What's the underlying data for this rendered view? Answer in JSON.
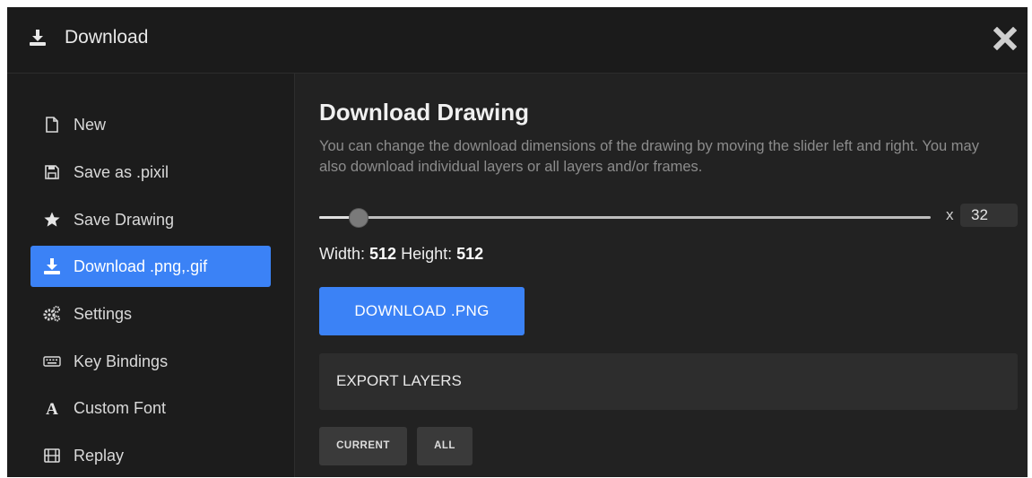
{
  "titlebar": {
    "title": "Download",
    "icon": "download-icon",
    "close_icon": "close-icon"
  },
  "sidebar": {
    "items": [
      {
        "label": "New",
        "icon": "file-icon",
        "active": false
      },
      {
        "label": "Save as .pixil",
        "icon": "floppy-disk-icon",
        "active": false
      },
      {
        "label": "Save Drawing",
        "icon": "star-icon",
        "active": false
      },
      {
        "label": "Download .png,.gif",
        "icon": "download-icon",
        "active": true
      },
      {
        "label": "Settings",
        "icon": "gears-icon",
        "active": false
      },
      {
        "label": "Key Bindings",
        "icon": "keyboard-icon",
        "active": false
      },
      {
        "label": "Custom Font",
        "icon": "font-icon",
        "active": false
      },
      {
        "label": "Replay",
        "icon": "film-icon",
        "active": false
      }
    ]
  },
  "main": {
    "heading": "Download Drawing",
    "description": "You can change the download dimensions of the drawing by moving the slider left and right. You may also download individual layers or all layers and/or frames.",
    "slider": {
      "level": 0.064
    },
    "scale_prefix": "x",
    "scale_value": "32",
    "dims": {
      "width_label": "Width:",
      "width_value": "512",
      "height_label": "Height:",
      "height_value": "512"
    },
    "download_button": "DOWNLOAD .PNG",
    "export_layers": "EXPORT LAYERS",
    "layer_buttons": {
      "current": "CURRENT",
      "all": "ALL"
    }
  },
  "colors": {
    "accent": "#3b82f6",
    "background": "#1f1f1f"
  }
}
